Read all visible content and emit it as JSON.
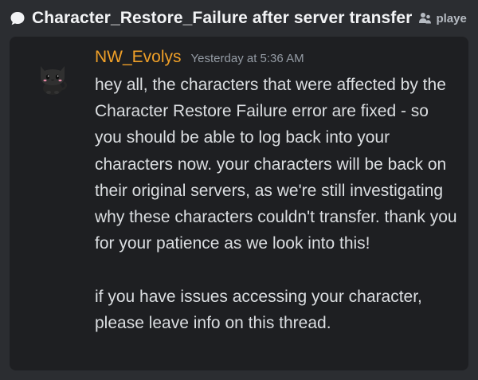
{
  "thread": {
    "icon": "speech-bubble-icon",
    "title": "Character_Restore_Failure after server transfer",
    "tag_icon": "player-tag-icon",
    "tag_label": "playe"
  },
  "message": {
    "avatar": "black-cat-avatar",
    "author": "NW_Evolys",
    "author_color": "#f0a028",
    "timestamp": "Yesterday at 5:36 AM",
    "paragraph_1": "hey all, the characters that were affected by the Character Restore Failure error are fixed - so you should be able to log back into your characters now. your characters will be back on their original servers, as we're still investigating why these characters couldn't transfer. thank you for your patience as we look into this!",
    "paragraph_2": "if you have issues accessing your character, please leave info on this thread."
  }
}
